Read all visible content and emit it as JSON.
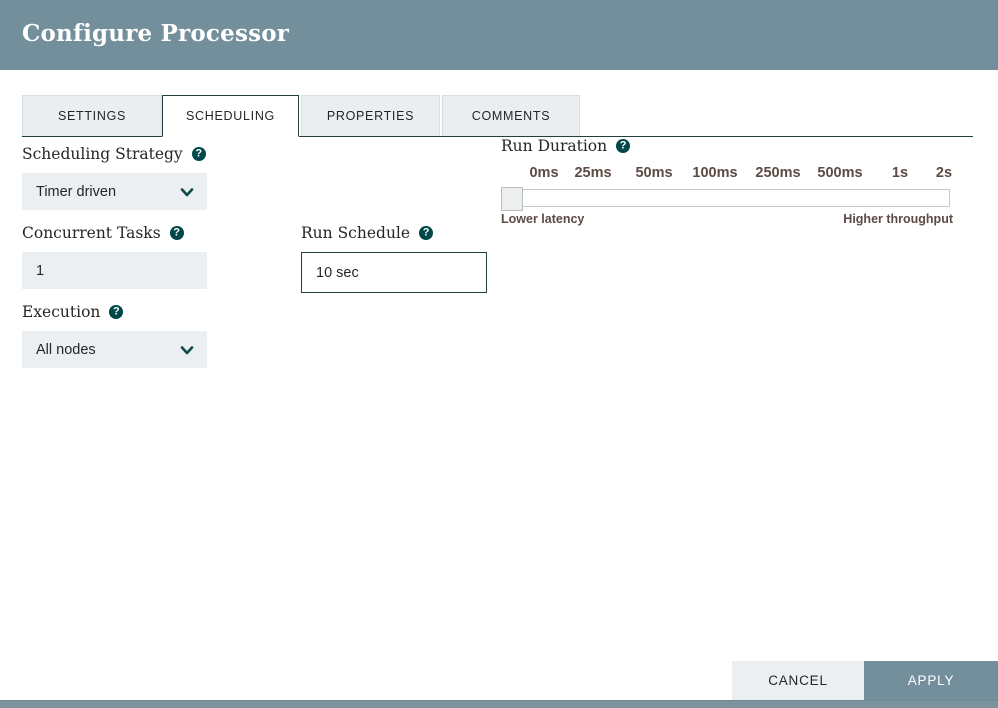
{
  "dialog": {
    "title": "Configure Processor"
  },
  "tabs": [
    {
      "label": "SETTINGS",
      "active": false
    },
    {
      "label": "SCHEDULING",
      "active": true
    },
    {
      "label": "PROPERTIES",
      "active": false
    },
    {
      "label": "COMMENTS",
      "active": false
    }
  ],
  "fields": {
    "scheduling_strategy": {
      "label": "Scheduling Strategy",
      "help": "?",
      "value": "Timer driven",
      "type": "select"
    },
    "concurrent_tasks": {
      "label": "Concurrent Tasks",
      "help": "?",
      "value": "1",
      "type": "text"
    },
    "execution": {
      "label": "Execution",
      "help": "?",
      "value": "All nodes",
      "type": "select"
    },
    "run_schedule": {
      "label": "Run Schedule",
      "help": "?",
      "value": "10 sec",
      "type": "text",
      "focused": true
    }
  },
  "run_duration": {
    "label": "Run Duration",
    "help": "?",
    "ticks": [
      "0ms",
      "25ms",
      "50ms",
      "100ms",
      "250ms",
      "500ms",
      "1s",
      "2s"
    ],
    "tick_positions": [
      9,
      38,
      67,
      96,
      125,
      154,
      183,
      212
    ],
    "selected_index": 0,
    "selected_value": "0ms",
    "left_endpoint": "Lower latency",
    "right_endpoint": "Higher throughput"
  },
  "footer": {
    "cancel_label": "CANCEL",
    "apply_label": "APPLY"
  },
  "colors": {
    "header": "#728f9b",
    "accent": "#004849",
    "tick_text": "#5d4a44",
    "control_bg": "#eceff1",
    "apply_bg": "#728f9b"
  }
}
